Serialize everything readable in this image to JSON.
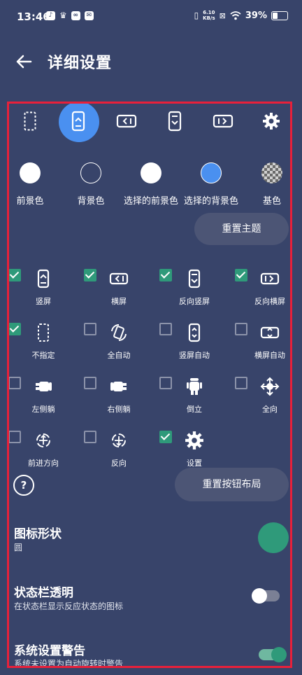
{
  "status_bar": {
    "time": "13:46",
    "net_speed_top": "6.10",
    "net_speed_bottom": "KB/s",
    "battery": "39%"
  },
  "header": {
    "title": "详细设置"
  },
  "orientation_tabs": [
    {
      "name": "unspecified"
    },
    {
      "name": "portrait",
      "active": true
    },
    {
      "name": "landscape"
    },
    {
      "name": "reverse-portrait"
    },
    {
      "name": "reverse-landscape"
    },
    {
      "name": "settings"
    }
  ],
  "colors": {
    "items": [
      {
        "label": "前景色",
        "color": "#ffffff"
      },
      {
        "label": "背景色",
        "color": "#38446a"
      },
      {
        "label": "选择的前景色",
        "color": "#ffffff"
      },
      {
        "label": "选择的背景色",
        "color": "#4a90f0"
      },
      {
        "label": "基色",
        "color": "checker"
      }
    ],
    "reset_theme": "重置主题"
  },
  "buttons": [
    {
      "label": "竖屏",
      "checked": true,
      "icon": "portrait-icon"
    },
    {
      "label": "横屏",
      "checked": true,
      "icon": "landscape-icon"
    },
    {
      "label": "反向竖屏",
      "checked": true,
      "icon": "reverse-portrait-icon"
    },
    {
      "label": "反向横屏",
      "checked": true,
      "icon": "reverse-landscape-icon"
    },
    {
      "label": "不指定",
      "checked": true,
      "icon": "unspecified-icon"
    },
    {
      "label": "全自动",
      "checked": false,
      "icon": "full-auto-icon"
    },
    {
      "label": "竖屏自动",
      "checked": false,
      "icon": "portrait-auto-icon"
    },
    {
      "label": "横屏自动",
      "checked": false,
      "icon": "landscape-auto-icon"
    },
    {
      "label": "左侧躺",
      "checked": false,
      "icon": "lie-left-icon"
    },
    {
      "label": "右侧躺",
      "checked": false,
      "icon": "lie-right-icon"
    },
    {
      "label": "倒立",
      "checked": false,
      "icon": "headstand-icon"
    },
    {
      "label": "全向",
      "checked": false,
      "icon": "omni-icon"
    },
    {
      "label": "前进方向",
      "checked": false,
      "icon": "forward-direction-icon"
    },
    {
      "label": "反向",
      "checked": false,
      "icon": "reverse-direction-icon"
    },
    {
      "label": "设置",
      "checked": true,
      "icon": "gear-icon"
    }
  ],
  "help_label": "?",
  "reset_layout": "重置按钮布局",
  "settings": {
    "icon_shape": {
      "title": "图标形状",
      "value": "圆",
      "color": "#2f9a7a"
    },
    "statusbar_transparent": {
      "title": "状态栏透明",
      "subtitle": "在状态栏显示反应状态的图标",
      "on": false
    },
    "system_warning": {
      "title": "系统设置警告",
      "subtitle": "系统未设置为自动旋转时警告",
      "on": true
    }
  },
  "accent": "#2f9a7a",
  "active_tab_color": "#4a90f0"
}
